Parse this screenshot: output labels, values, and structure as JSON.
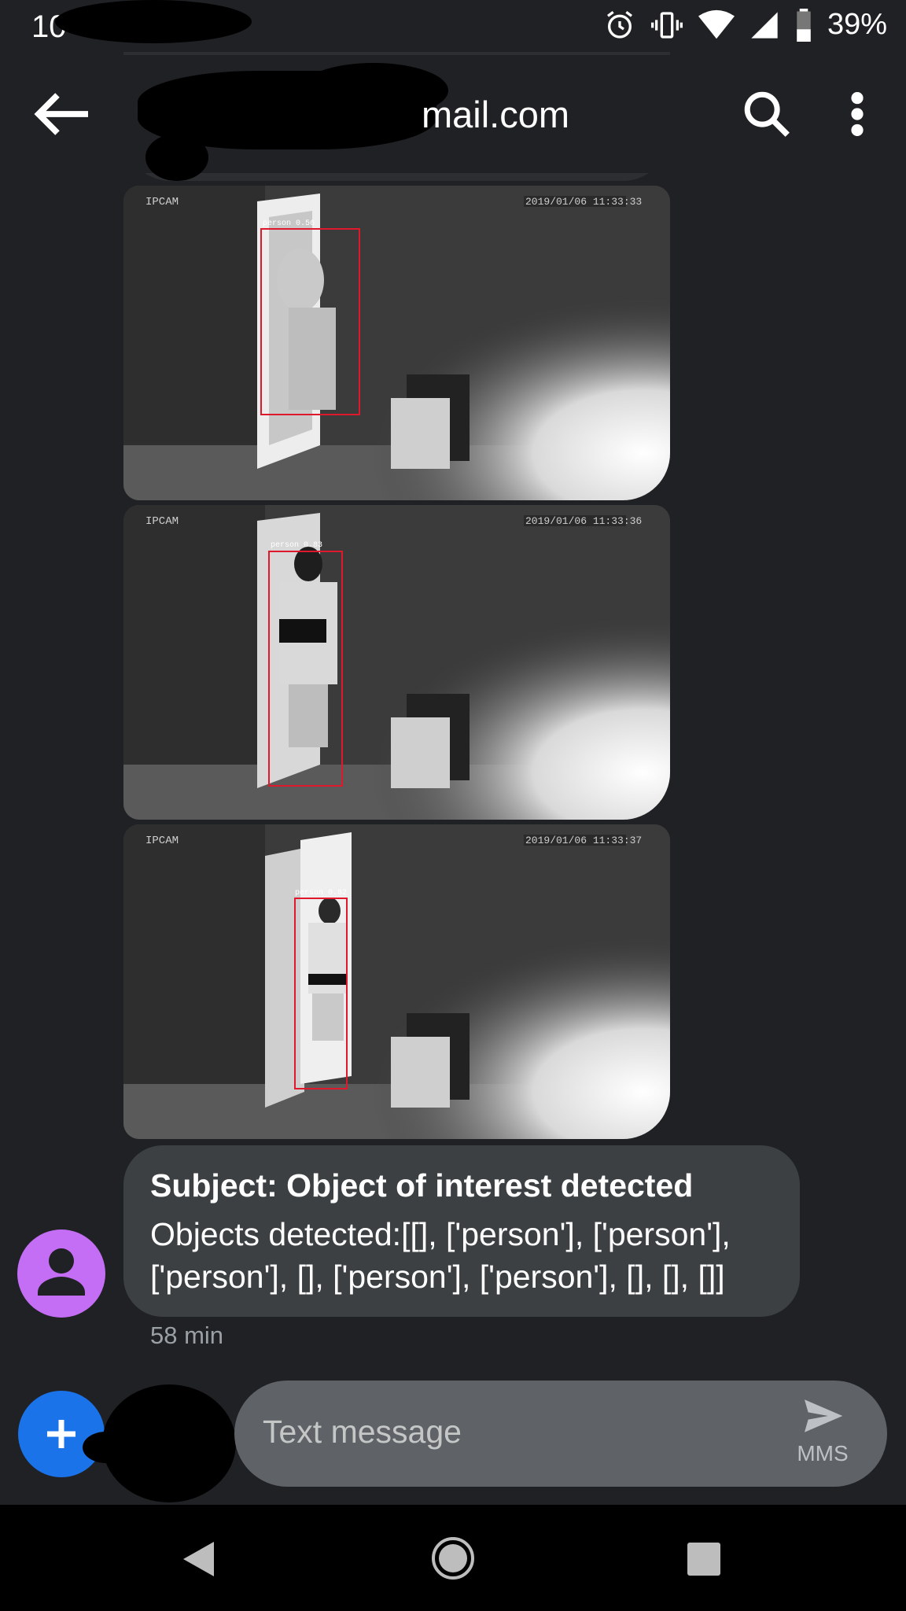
{
  "status_bar": {
    "time": "10",
    "battery_percent": "39%",
    "icons": [
      "alarm-icon",
      "vibrate-icon",
      "wifi-icon",
      "cell-signal-icon",
      "battery-icon"
    ]
  },
  "app_bar": {
    "title": "mail.com",
    "back_icon": "arrow-back-icon",
    "search_icon": "search-icon",
    "more_icon": "more-vert-icon"
  },
  "images": [
    {
      "watermark": "IPCAM",
      "timestamp": "2019/01/06 11:33:33",
      "detection_label": "person 0.56"
    },
    {
      "watermark": "IPCAM",
      "timestamp": "2019/01/06 11:33:36",
      "detection_label": "person 0.83"
    },
    {
      "watermark": "IPCAM",
      "timestamp": "2019/01/06 11:33:37",
      "detection_label": "person 0.82"
    }
  ],
  "message": {
    "subject": "Subject: Object of interest detected",
    "body": "Objects detected:[[], ['person'], ['person'], ['person'], [], ['person'], ['person'], [], [], []]",
    "time": "58 min"
  },
  "compose": {
    "placeholder": "Text message",
    "send_label": "MMS"
  },
  "colors": {
    "background": "#202124",
    "bubble": "#3c4043",
    "avatar": "#c36ef4",
    "fab": "#1a73e8",
    "detection_box": "#e0182c"
  }
}
